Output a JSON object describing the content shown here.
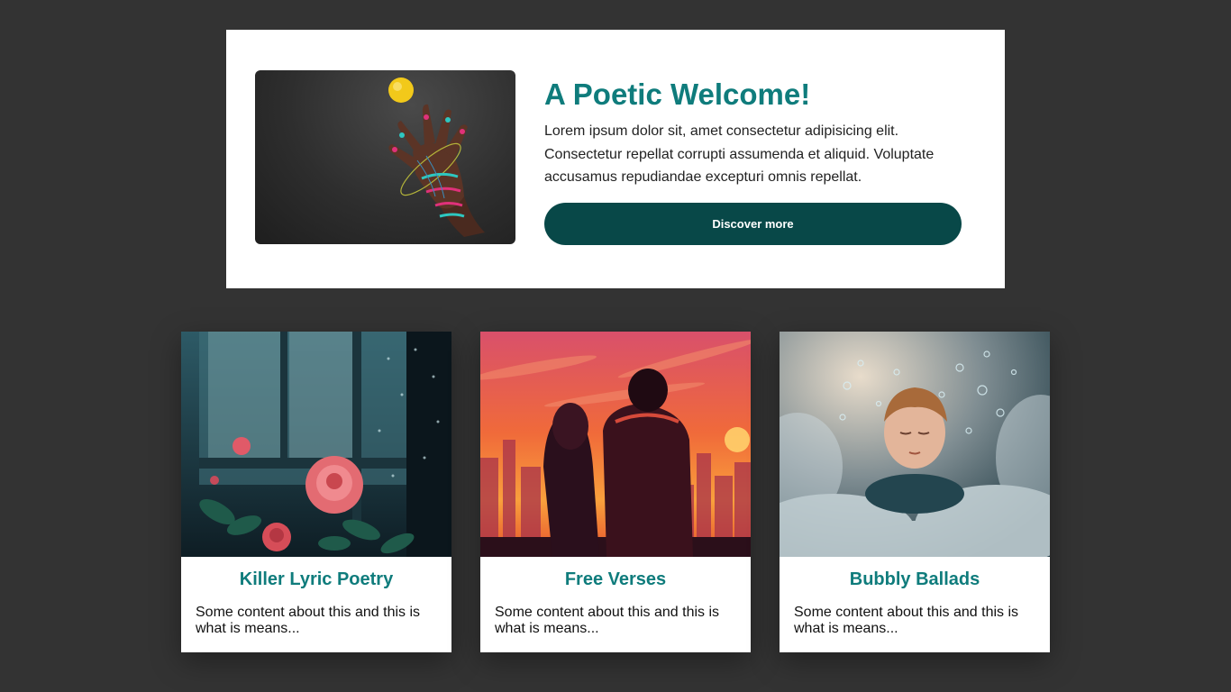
{
  "hero": {
    "title": "A Poetic Welcome!",
    "text": "Lorem ipsum dolor sit, amet consectetur adipisicing elit. Consectetur repellat corrupti assumenda et aliquid. Voluptate accusamus repudiandae excepturi omnis repellat.",
    "button_label": "Discover more",
    "image_subject": "hand-with-yellow-ball"
  },
  "cards": [
    {
      "title": "Killer Lyric Poetry",
      "text": "Some content about this and this is what is means...",
      "image_subject": "rose-by-rainy-window"
    },
    {
      "title": "Free Verses",
      "text": "Some content about this and this is what is means...",
      "image_subject": "couple-at-sunset-city"
    },
    {
      "title": "Bubbly Ballads",
      "text": "Some content about this and this is what is means...",
      "image_subject": "boy-in-clouds-with-bubbles"
    }
  ],
  "colors": {
    "page_background": "#333333",
    "accent": "#0f7c7c",
    "button": "#084848"
  }
}
